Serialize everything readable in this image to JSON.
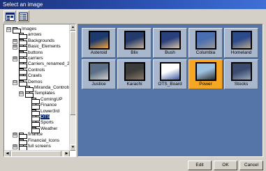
{
  "window": {
    "title": "Select an image"
  },
  "toolbar": {
    "buttons": [
      {
        "icon": "folder-view-icon"
      },
      {
        "icon": "list-view-icon"
      }
    ]
  },
  "tree": {
    "items": [
      {
        "label": "Images",
        "expander": "⊟"
      },
      {
        "label": "arrows"
      },
      {
        "label": "Backgrounds",
        "expander": "⊞"
      },
      {
        "label": "Basic_Elements",
        "expander": "⊞"
      },
      {
        "label": "buttons"
      },
      {
        "label": "carriers",
        "expander": "⊞"
      },
      {
        "label": "Carriers_renamed_2"
      },
      {
        "label": "Controls"
      },
      {
        "label": "Crawls"
      },
      {
        "label": "Demos",
        "expander": "⊟"
      },
      {
        "label": "Miranda_Controls"
      },
      {
        "label": "Templates",
        "expander": "⊟"
      },
      {
        "label": "ComingUP"
      },
      {
        "label": "Finance"
      },
      {
        "label": "Lower3rd"
      },
      {
        "label": "OTS",
        "selected": true
      },
      {
        "label": "Sports"
      },
      {
        "label": "Weather"
      },
      {
        "label": "finance",
        "expander": "⊞"
      },
      {
        "label": "Financial_Icons"
      },
      {
        "label": "full screens",
        "expander": "⊞"
      }
    ]
  },
  "gallery": {
    "images": [
      {
        "caption": "Asteroid",
        "colors": [
          "#1c3a6e",
          "#f2a43a"
        ]
      },
      {
        "caption": "Blix",
        "colors": [
          "#243a6a",
          "#c9b39a"
        ]
      },
      {
        "caption": "Bush",
        "colors": [
          "#2a3f7d",
          "#d8c2a8"
        ]
      },
      {
        "caption": "Columbia",
        "colors": [
          "#4a6fb0",
          "#9a9a9a"
        ]
      },
      {
        "caption": "Homeland",
        "colors": [
          "#2c4a8a",
          "#b8a890"
        ]
      },
      {
        "caption": "Justice",
        "colors": [
          "#5a6f86",
          "#d0d0d0"
        ]
      },
      {
        "caption": "Karachi",
        "colors": [
          "#3b3b3b",
          "#8a7a66"
        ]
      },
      {
        "caption": "OTS_Board",
        "colors": [
          "#ffffff",
          "#3a5aa0"
        ]
      },
      {
        "caption": "Power",
        "colors": [
          "#9cc0e0",
          "#2e2e2e"
        ],
        "selected": true
      },
      {
        "caption": "Stocks",
        "colors": [
          "#3a4a6e",
          "#9aa8bc"
        ]
      }
    ]
  },
  "footer": {
    "edit": "Edit",
    "ok": "OK",
    "cancel": "Cancel"
  }
}
